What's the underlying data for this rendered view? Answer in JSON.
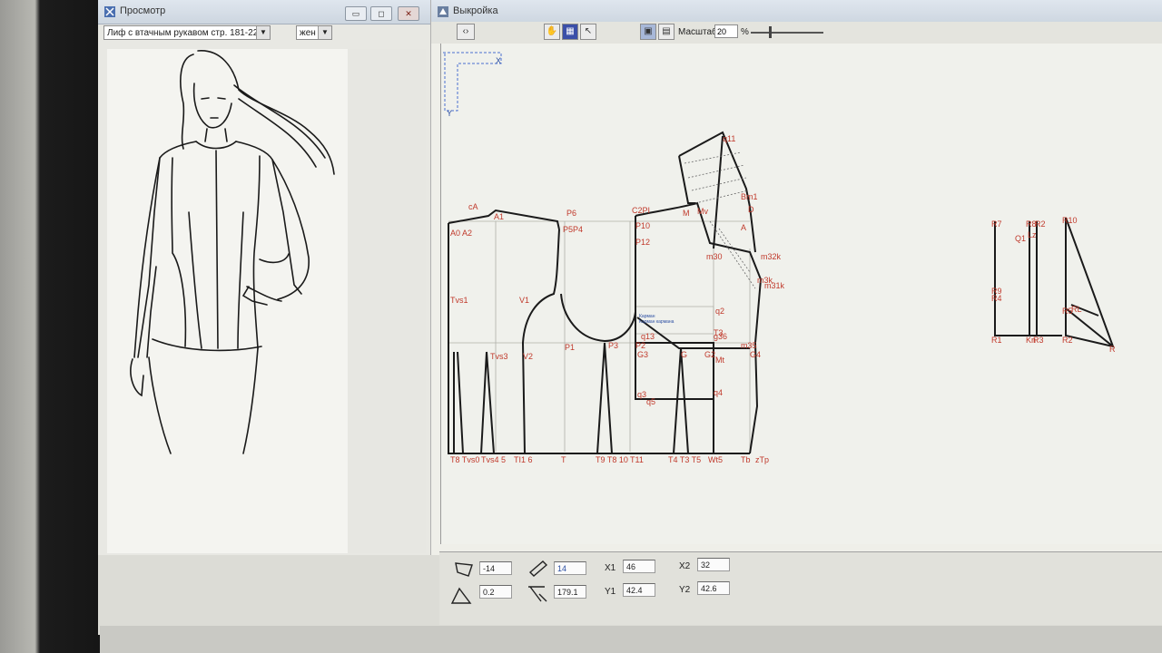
{
  "preview_window": {
    "title": "Просмотр",
    "model_select": "Лиф с втачным рукавом стр. 181-225",
    "gender_select": "жен",
    "buttons": {
      "minimize": "▭",
      "maximize": "◻",
      "close": "✕"
    }
  },
  "pattern_window": {
    "title": "Выкройка",
    "scale_label": "Масштаб",
    "scale_value": "20",
    "scale_unit": "%"
  },
  "axis": {
    "x": "X",
    "y": "Y"
  },
  "pattern_labels": {
    "cA": "cA",
    "A1": "A1",
    "A0A2": "A0 A2",
    "P6": "P6",
    "C2PI": "C2PI",
    "P5P4": "P5P4",
    "P10": "P10",
    "P12": "P12",
    "Tvs1": "Tvs1",
    "V1": "V1",
    "V2": "V2",
    "Tvs3": "Tvs3",
    "P1": "P1",
    "P3": "P3",
    "P2": "P2",
    "G3": "G3",
    "q13": "q13",
    "q5": "q5",
    "q2": "q2",
    "q3": "q3",
    "q4": "q4",
    "G": "G",
    "G2": "G2",
    "G4": "G4",
    "Mt": "Mt",
    "m35": "m35",
    "g36": "g36",
    "T3": "T3",
    "bottom_left": "T8 Tvs0",
    "bottom_tvs": "Tvs4 5",
    "bottom_tt": "TI1 6",
    "T": "T",
    "T9": "T9 T8 10",
    "T11": "T11",
    "T4T5": "T4 T3 T5",
    "bottom_w": "Wt5",
    "Tb": "Tb",
    "zTp": "zTp",
    "m32k": "m32k",
    "m31k": "m31k",
    "m3k": "m3k",
    "m30": "m30",
    "sleeve_top": "q11",
    "M": "M",
    "Mv": "Mv",
    "A": "A",
    "D": "D",
    "Bm1": "Bm1",
    "pocket1": "Карман",
    "pocket2": "Карман кармана",
    "R7": "R7",
    "R8": "R8",
    "R2a": "R2",
    "R10": "R10",
    "Q1": "Q1",
    "Lz": "Lz",
    "R9": "R9",
    "R4": "R4",
    "R1": "R1",
    "Kn": "Kn",
    "R3": "R3",
    "R2": "R2",
    "R": "R",
    "R5": "R5",
    "RL": "RL"
  },
  "params": {
    "field1": "-14",
    "field2": "14",
    "x1_label": "X1",
    "x1": "46",
    "x2_label": "X2",
    "x2": "32",
    "field3": "0.2",
    "field4": "179.1",
    "y1_label": "Y1",
    "y1": "42.4",
    "y2_label": "Y2",
    "y2": "42.6"
  }
}
